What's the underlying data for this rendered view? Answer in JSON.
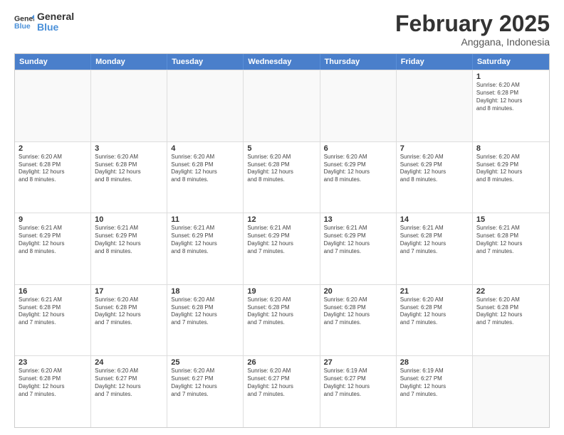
{
  "header": {
    "logo_general": "General",
    "logo_blue": "Blue",
    "title": "February 2025",
    "subtitle": "Anggana, Indonesia"
  },
  "days_of_week": [
    "Sunday",
    "Monday",
    "Tuesday",
    "Wednesday",
    "Thursday",
    "Friday",
    "Saturday"
  ],
  "weeks": [
    [
      {
        "day": "",
        "empty": true
      },
      {
        "day": "",
        "empty": true
      },
      {
        "day": "",
        "empty": true
      },
      {
        "day": "",
        "empty": true
      },
      {
        "day": "",
        "empty": true
      },
      {
        "day": "",
        "empty": true
      },
      {
        "day": "1",
        "sunrise": "Sunrise: 6:20 AM",
        "sunset": "Sunset: 6:28 PM",
        "daylight": "Daylight: 12 hours and 8 minutes."
      }
    ],
    [
      {
        "day": "2",
        "sunrise": "Sunrise: 6:20 AM",
        "sunset": "Sunset: 6:28 PM",
        "daylight": "Daylight: 12 hours and 8 minutes."
      },
      {
        "day": "3",
        "sunrise": "Sunrise: 6:20 AM",
        "sunset": "Sunset: 6:28 PM",
        "daylight": "Daylight: 12 hours and 8 minutes."
      },
      {
        "day": "4",
        "sunrise": "Sunrise: 6:20 AM",
        "sunset": "Sunset: 6:28 PM",
        "daylight": "Daylight: 12 hours and 8 minutes."
      },
      {
        "day": "5",
        "sunrise": "Sunrise: 6:20 AM",
        "sunset": "Sunset: 6:28 PM",
        "daylight": "Daylight: 12 hours and 8 minutes."
      },
      {
        "day": "6",
        "sunrise": "Sunrise: 6:20 AM",
        "sunset": "Sunset: 6:29 PM",
        "daylight": "Daylight: 12 hours and 8 minutes."
      },
      {
        "day": "7",
        "sunrise": "Sunrise: 6:20 AM",
        "sunset": "Sunset: 6:29 PM",
        "daylight": "Daylight: 12 hours and 8 minutes."
      },
      {
        "day": "8",
        "sunrise": "Sunrise: 6:20 AM",
        "sunset": "Sunset: 6:29 PM",
        "daylight": "Daylight: 12 hours and 8 minutes."
      }
    ],
    [
      {
        "day": "9",
        "sunrise": "Sunrise: 6:21 AM",
        "sunset": "Sunset: 6:29 PM",
        "daylight": "Daylight: 12 hours and 8 minutes."
      },
      {
        "day": "10",
        "sunrise": "Sunrise: 6:21 AM",
        "sunset": "Sunset: 6:29 PM",
        "daylight": "Daylight: 12 hours and 8 minutes."
      },
      {
        "day": "11",
        "sunrise": "Sunrise: 6:21 AM",
        "sunset": "Sunset: 6:29 PM",
        "daylight": "Daylight: 12 hours and 8 minutes."
      },
      {
        "day": "12",
        "sunrise": "Sunrise: 6:21 AM",
        "sunset": "Sunset: 6:29 PM",
        "daylight": "Daylight: 12 hours and 7 minutes."
      },
      {
        "day": "13",
        "sunrise": "Sunrise: 6:21 AM",
        "sunset": "Sunset: 6:29 PM",
        "daylight": "Daylight: 12 hours and 7 minutes."
      },
      {
        "day": "14",
        "sunrise": "Sunrise: 6:21 AM",
        "sunset": "Sunset: 6:28 PM",
        "daylight": "Daylight: 12 hours and 7 minutes."
      },
      {
        "day": "15",
        "sunrise": "Sunrise: 6:21 AM",
        "sunset": "Sunset: 6:28 PM",
        "daylight": "Daylight: 12 hours and 7 minutes."
      }
    ],
    [
      {
        "day": "16",
        "sunrise": "Sunrise: 6:21 AM",
        "sunset": "Sunset: 6:28 PM",
        "daylight": "Daylight: 12 hours and 7 minutes."
      },
      {
        "day": "17",
        "sunrise": "Sunrise: 6:20 AM",
        "sunset": "Sunset: 6:28 PM",
        "daylight": "Daylight: 12 hours and 7 minutes."
      },
      {
        "day": "18",
        "sunrise": "Sunrise: 6:20 AM",
        "sunset": "Sunset: 6:28 PM",
        "daylight": "Daylight: 12 hours and 7 minutes."
      },
      {
        "day": "19",
        "sunrise": "Sunrise: 6:20 AM",
        "sunset": "Sunset: 6:28 PM",
        "daylight": "Daylight: 12 hours and 7 minutes."
      },
      {
        "day": "20",
        "sunrise": "Sunrise: 6:20 AM",
        "sunset": "Sunset: 6:28 PM",
        "daylight": "Daylight: 12 hours and 7 minutes."
      },
      {
        "day": "21",
        "sunrise": "Sunrise: 6:20 AM",
        "sunset": "Sunset: 6:28 PM",
        "daylight": "Daylight: 12 hours and 7 minutes."
      },
      {
        "day": "22",
        "sunrise": "Sunrise: 6:20 AM",
        "sunset": "Sunset: 6:28 PM",
        "daylight": "Daylight: 12 hours and 7 minutes."
      }
    ],
    [
      {
        "day": "23",
        "sunrise": "Sunrise: 6:20 AM",
        "sunset": "Sunset: 6:28 PM",
        "daylight": "Daylight: 12 hours and 7 minutes."
      },
      {
        "day": "24",
        "sunrise": "Sunrise: 6:20 AM",
        "sunset": "Sunset: 6:27 PM",
        "daylight": "Daylight: 12 hours and 7 minutes."
      },
      {
        "day": "25",
        "sunrise": "Sunrise: 6:20 AM",
        "sunset": "Sunset: 6:27 PM",
        "daylight": "Daylight: 12 hours and 7 minutes."
      },
      {
        "day": "26",
        "sunrise": "Sunrise: 6:20 AM",
        "sunset": "Sunset: 6:27 PM",
        "daylight": "Daylight: 12 hours and 7 minutes."
      },
      {
        "day": "27",
        "sunrise": "Sunrise: 6:19 AM",
        "sunset": "Sunset: 6:27 PM",
        "daylight": "Daylight: 12 hours and 7 minutes."
      },
      {
        "day": "28",
        "sunrise": "Sunrise: 6:19 AM",
        "sunset": "Sunset: 6:27 PM",
        "daylight": "Daylight: 12 hours and 7 minutes."
      },
      {
        "day": "",
        "empty": true
      }
    ]
  ]
}
